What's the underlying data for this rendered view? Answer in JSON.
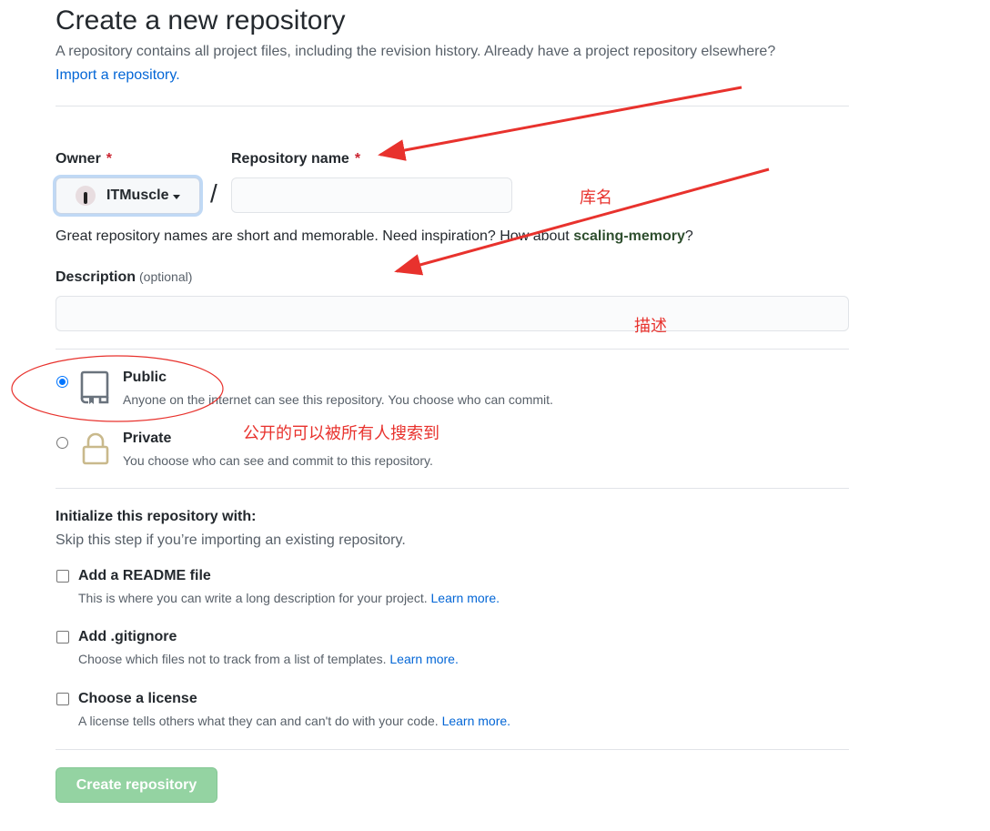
{
  "header": {
    "title": "Create a new repository",
    "subtitle": "A repository contains all project files, including the revision history. Already have a project repository elsewhere?",
    "import_link": "Import a repository."
  },
  "owner": {
    "label": "Owner",
    "required_mark": "*",
    "selected": "ITMuscle",
    "separator": "/"
  },
  "repo_name": {
    "label": "Repository name",
    "required_mark": "*",
    "value": "",
    "hint_prefix": "Great repository names are short and memorable. Need inspiration? How about ",
    "suggestion": "scaling-memory",
    "hint_suffix": "?"
  },
  "description": {
    "label": "Description",
    "optional": "(optional)",
    "value": ""
  },
  "visibility": {
    "selected": "public",
    "public": {
      "title": "Public",
      "desc": "Anyone on the internet can see this repository. You choose who can commit."
    },
    "private": {
      "title": "Private",
      "desc": "You choose who can see and commit to this repository."
    }
  },
  "initialize": {
    "title": "Initialize this repository with:",
    "subtitle": "Skip this step if you’re importing an existing repository.",
    "options": [
      {
        "title": "Add a README file",
        "desc": "This is where you can write a long description for your project.",
        "link": "Learn more.",
        "checked": false
      },
      {
        "title": "Add .gitignore",
        "desc": "Choose which files not to track from a list of templates.",
        "link": "Learn more.",
        "checked": false
      },
      {
        "title": "Choose a license",
        "desc": "A license tells others what they can and can't do with your code.",
        "link": "Learn more.",
        "checked": false
      }
    ]
  },
  "create_button": "Create repository",
  "annotations": {
    "repo_name_note": "库名",
    "description_note": "描述",
    "public_note": "公开的可以被所有人搜索到",
    "color": "#e8322d"
  },
  "colors": {
    "link": "#0366d6",
    "required": "#cb2431",
    "create_button_bg": "#94d3a2",
    "radio_checked": "#0075ff"
  },
  "icons": {
    "public": "repo-icon",
    "private": "lock-icon"
  }
}
